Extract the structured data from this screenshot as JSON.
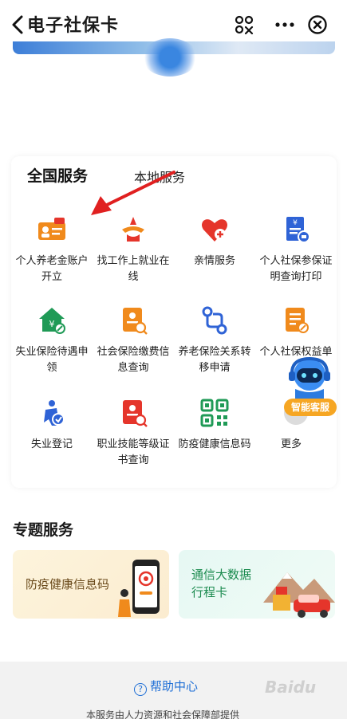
{
  "header": {
    "title": "电子社保卡"
  },
  "tabs": [
    {
      "label": "全国服务",
      "active": true
    },
    {
      "label": "本地服务",
      "active": false
    }
  ],
  "services": [
    {
      "label": "个人养老金账户开立",
      "icon": "pension-account-icon"
    },
    {
      "label": "找工作上就业在线",
      "icon": "job-search-icon"
    },
    {
      "label": "亲情服务",
      "icon": "family-heart-icon"
    },
    {
      "label": "个人社保参保证明查询打印",
      "icon": "insurance-certificate-icon"
    },
    {
      "label": "失业保险待遇申领",
      "icon": "unemployment-benefit-icon"
    },
    {
      "label": "社会保险缴费信息查询",
      "icon": "payment-query-icon"
    },
    {
      "label": "养老保险关系转移申请",
      "icon": "pension-transfer-icon"
    },
    {
      "label": "个人社保权益单",
      "icon": "rights-document-icon"
    },
    {
      "label": "失业登记",
      "icon": "unemployment-register-icon"
    },
    {
      "label": "职业技能等级证书查询",
      "icon": "skill-certificate-icon"
    },
    {
      "label": "防疫健康信息码",
      "icon": "qr-code-icon"
    },
    {
      "label": "更多",
      "icon": "more-icon"
    }
  ],
  "assistant": {
    "label": "智能客服"
  },
  "topic": {
    "title": "专题服务",
    "cards": [
      {
        "label": "防疫健康信息码"
      },
      {
        "label_line1": "通信大数据",
        "label_line2": "行程卡"
      }
    ]
  },
  "footer": {
    "help": "帮助中心",
    "provider": "本服务由人力资源和社会保障部提供",
    "watermark": "Baidu"
  },
  "colors": {
    "accent": "#1f6fd6",
    "icon_orange": "#f08a1c",
    "icon_red": "#e5352b",
    "icon_blue": "#2f63d6",
    "icon_green": "#1f9a56",
    "arrow": "#e02020"
  }
}
